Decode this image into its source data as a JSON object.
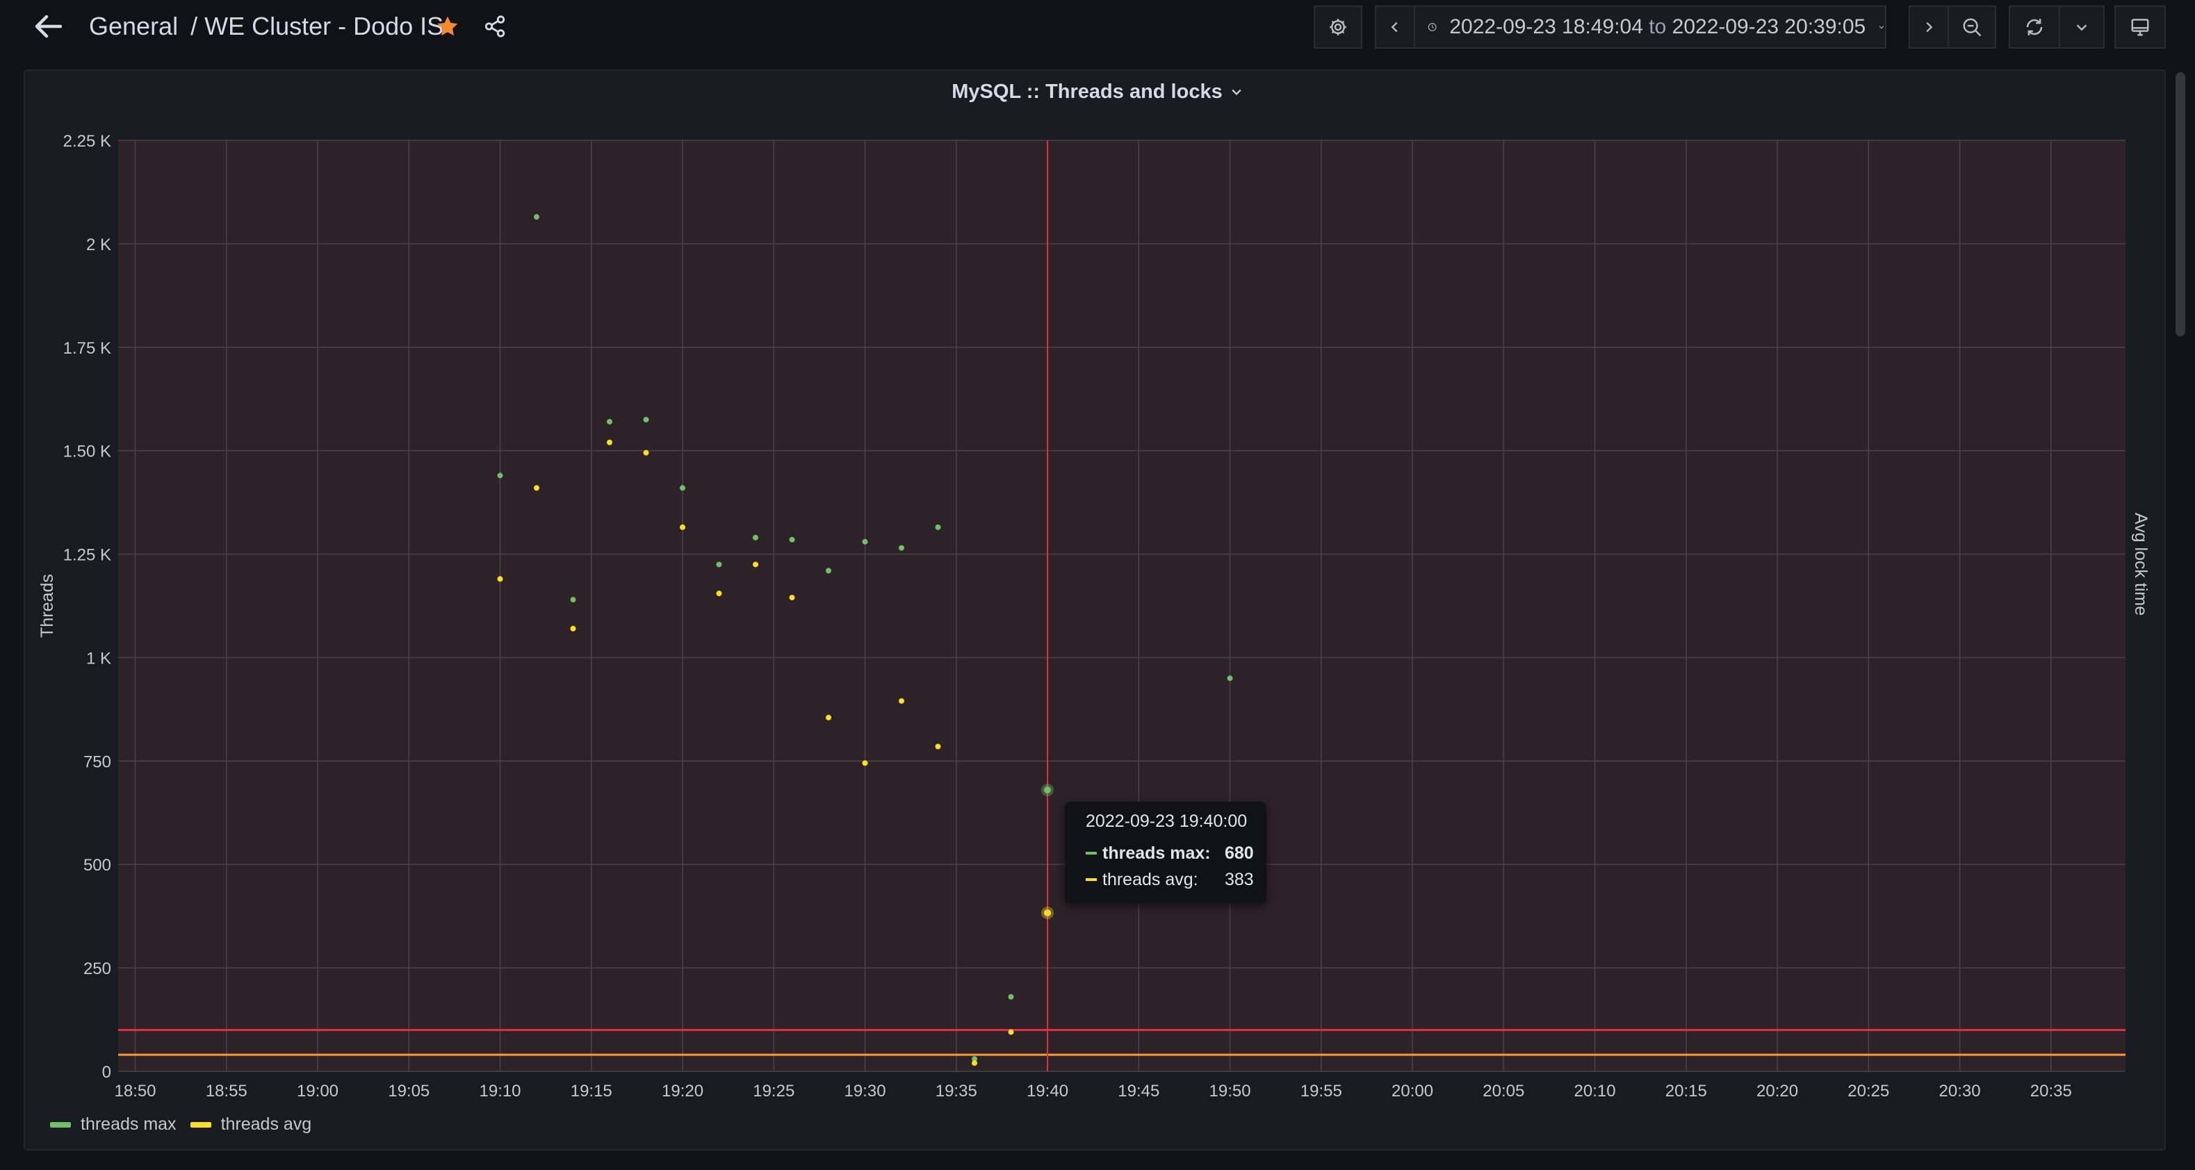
{
  "header": {
    "breadcrumb_folder": "General",
    "breadcrumb_separator": "/",
    "dashboard_title": "WE Cluster - Dodo IS",
    "starred": true
  },
  "time_range": {
    "from": "2022-09-23 18:49:04",
    "to_label": "to",
    "to": "2022-09-23 20:39:05"
  },
  "icons": {
    "back": "arrow-left-icon",
    "star": "star-icon",
    "share": "share-icon",
    "settings": "gear-icon",
    "prev": "chevron-left-icon",
    "clock": "clock-icon",
    "dropdown": "chevron-down-icon",
    "next": "chevron-right-icon",
    "zoom_out": "zoom-out-icon",
    "refresh": "refresh-icon",
    "tv_mode": "monitor-icon"
  },
  "colors": {
    "threads_max": "#73bf69",
    "threads_avg": "#fade2a",
    "threshold_red": "#e02f44",
    "threshold_orange": "#ff9830",
    "star": "#f38a2d"
  },
  "panel": {
    "title": "MySQL :: Threads and locks"
  },
  "chart_data": {
    "type": "scatter",
    "title": "MySQL :: Threads and locks",
    "ylabel": "Threads",
    "y2label": "Avg lock time",
    "ylim": [
      0,
      2250
    ],
    "xlim": [
      "18:49:04",
      "20:39:05"
    ],
    "yticks": [
      "0",
      "250",
      "500",
      "750",
      "1 K",
      "1.25 K",
      "1.50 K",
      "1.75 K",
      "2 K",
      "2.25 K"
    ],
    "xticks": [
      "18:50",
      "18:55",
      "19:00",
      "19:05",
      "19:10",
      "19:15",
      "19:20",
      "19:25",
      "19:30",
      "19:35",
      "19:40",
      "19:45",
      "19:50",
      "19:55",
      "20:00",
      "20:05",
      "20:10",
      "20:15",
      "20:20",
      "20:25",
      "20:30",
      "20:35"
    ],
    "grid": true,
    "legend_position": "bottom-left",
    "thresholds": [
      {
        "value": 100,
        "color": "#e02f44"
      },
      {
        "value": 40,
        "color": "#ff9830"
      }
    ],
    "series": [
      {
        "name": "threads max",
        "color": "#73bf69",
        "points": [
          [
            "19:10",
            1440
          ],
          [
            "19:12",
            2065
          ],
          [
            "19:14",
            1140
          ],
          [
            "19:16",
            1570
          ],
          [
            "19:18",
            1575
          ],
          [
            "19:20",
            1410
          ],
          [
            "19:22",
            1225
          ],
          [
            "19:24",
            1290
          ],
          [
            "19:26",
            1285
          ],
          [
            "19:28",
            1210
          ],
          [
            "19:30",
            1280
          ],
          [
            "19:32",
            1265
          ],
          [
            "19:34",
            1315
          ],
          [
            "19:36",
            30
          ],
          [
            "19:38",
            180
          ],
          [
            "19:40",
            680
          ],
          [
            "19:50",
            950
          ]
        ]
      },
      {
        "name": "threads avg",
        "color": "#fade2a",
        "points": [
          [
            "19:10",
            1190
          ],
          [
            "19:12",
            1410
          ],
          [
            "19:14",
            1070
          ],
          [
            "19:16",
            1520
          ],
          [
            "19:18",
            1495
          ],
          [
            "19:20",
            1315
          ],
          [
            "19:22",
            1155
          ],
          [
            "19:24",
            1225
          ],
          [
            "19:26",
            1145
          ],
          [
            "19:28",
            855
          ],
          [
            "19:30",
            745
          ],
          [
            "19:32",
            895
          ],
          [
            "19:34",
            785
          ],
          [
            "19:36",
            20
          ],
          [
            "19:38",
            95
          ],
          [
            "19:40",
            383
          ]
        ]
      }
    ],
    "cursor_time": "19:40"
  },
  "tooltip": {
    "time": "2022-09-23 19:40:00",
    "rows": [
      {
        "label": "threads max:",
        "value": "680",
        "color": "#73bf69"
      },
      {
        "label": "threads avg:",
        "value": "383",
        "color": "#fade2a"
      }
    ]
  },
  "legend": {
    "items": [
      {
        "label": "threads max",
        "color": "#73bf69"
      },
      {
        "label": "threads avg",
        "color": "#fade2a"
      }
    ]
  }
}
